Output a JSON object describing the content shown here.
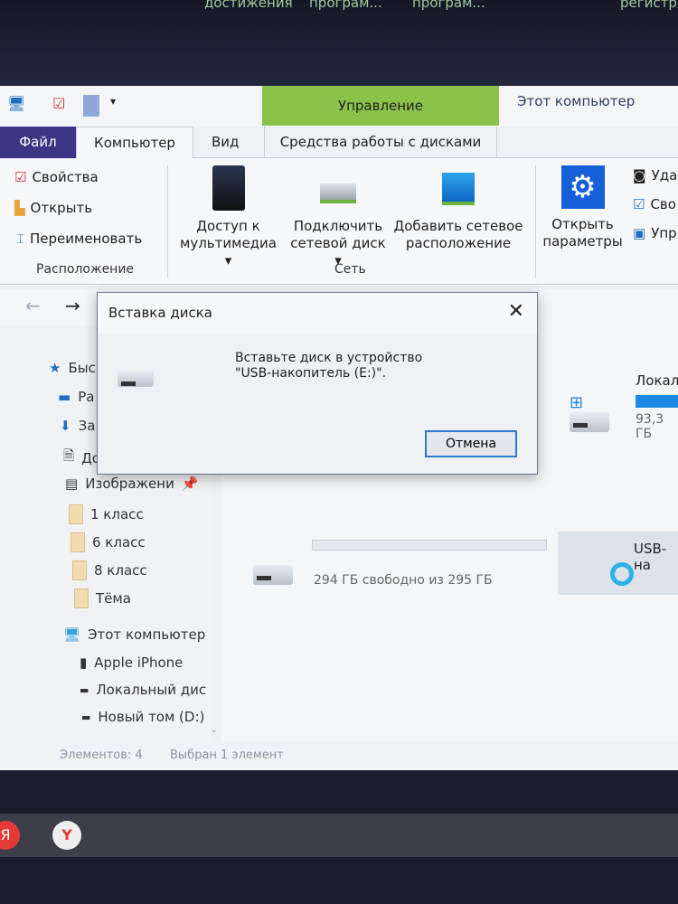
{
  "taskbar_top": {
    "items": [
      "достижения",
      "програм...",
      "програм...",
      "регистр"
    ]
  },
  "window": {
    "title": "Этот компьютер",
    "context_tab": "Управление"
  },
  "tabs": [
    {
      "label": "Файл"
    },
    {
      "label": "Компьютер"
    },
    {
      "label": "Вид"
    },
    {
      "label": "Средства работы с дисками"
    }
  ],
  "ribbon": {
    "location": {
      "label": "Расположение",
      "items": [
        "Свойства",
        "Открыть",
        "Переименовать"
      ]
    },
    "network": {
      "label": "Сеть",
      "media": [
        "Доступ к",
        "мультимедиа"
      ],
      "map": [
        "Подключить",
        "сетевой диск"
      ],
      "add": [
        "Добавить сетевое",
        "расположение"
      ]
    },
    "system": {
      "open": [
        "Открыть",
        "параметры"
      ],
      "items": [
        "Уда",
        "Сво",
        "Упр"
      ]
    }
  },
  "nav": {
    "items": [
      "Быс",
      "Ра",
      "За",
      "До",
      "Изображени",
      "1 класс",
      "6 класс",
      "8 класс",
      "Тёма",
      "Этот компьютер",
      "Apple iPhone",
      "Локальный дис",
      "Новый том (D:)"
    ]
  },
  "content": {
    "local": {
      "name": "Локал",
      "size": "93,3 ГБ",
      "usage": 0.9
    },
    "drive_free": "294 ГБ свободно из 295 ГБ",
    "usb": "USB-на"
  },
  "status": {
    "count": "Элементов: 4",
    "selected": "Выбран 1 элемент"
  },
  "dialog": {
    "title": "Вставка диска",
    "line1": "Вставьте диск в устройство",
    "line2": "\"USB-накопитель (E:)\".",
    "cancel": "Отмена"
  },
  "colors": {
    "manage": "#8bc34a",
    "file_tab": "#3b3585",
    "accent": "#2b7bd0"
  }
}
